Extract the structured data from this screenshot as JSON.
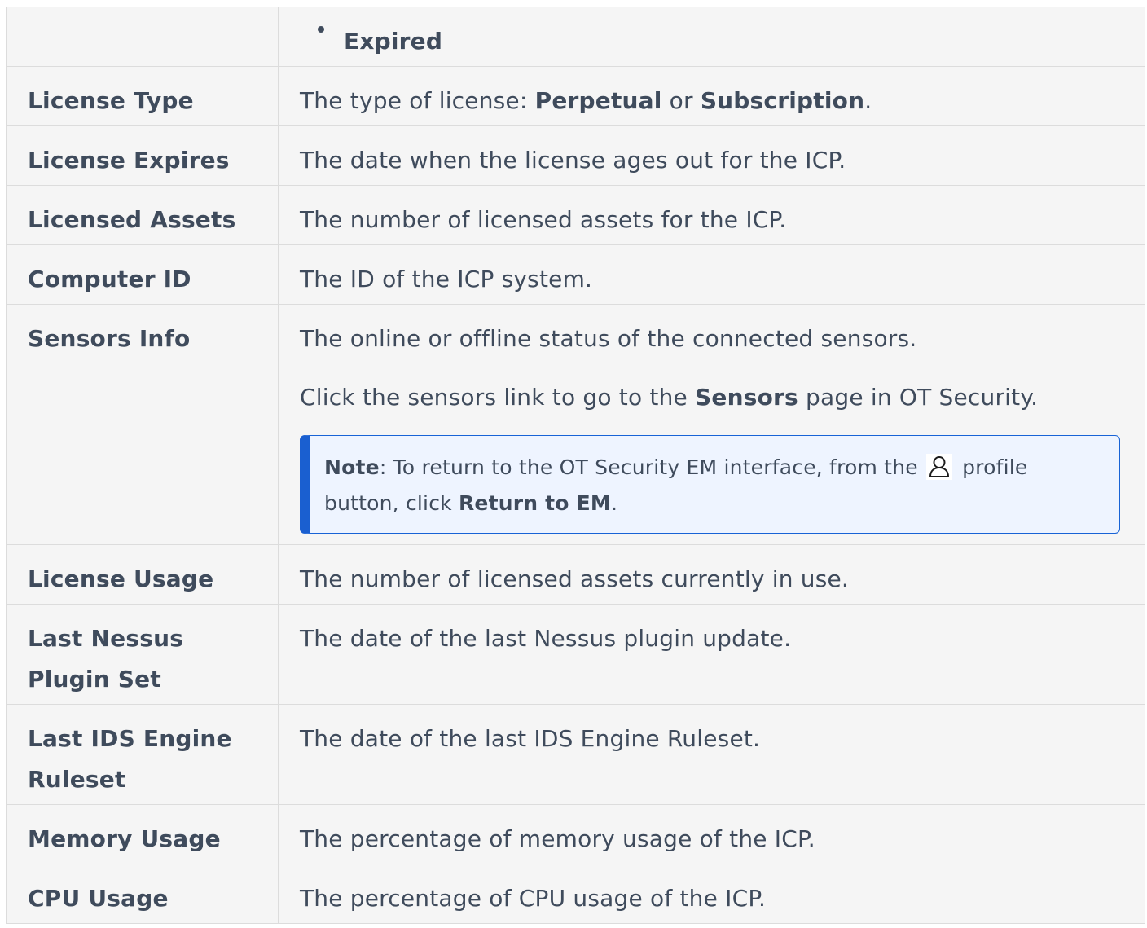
{
  "rows": {
    "expired_row": {
      "term": "",
      "bullet": "Expired"
    },
    "license_type": {
      "term": "License Type",
      "desc_prefix": "The type of license: ",
      "opt1": "Perpetual",
      "mid": " or ",
      "opt2": "Subscription",
      "desc_suffix": "."
    },
    "license_expires": {
      "term": "License Expires",
      "desc": "The date when the license ages out for the ICP."
    },
    "licensed_assets": {
      "term": "Licensed Assets",
      "desc": "The number of licensed assets for the ICP."
    },
    "computer_id": {
      "term": "Computer ID",
      "desc": "The ID of the ICP system."
    },
    "sensors_info": {
      "term": "Sensors Info",
      "desc": "The online or offline status of the connected sensors.",
      "para2_prefix": "Click the sensors link to go to the ",
      "para2_bold": "Sensors",
      "para2_suffix": " page in OT Security.",
      "note": {
        "label": "Note",
        "text1": ": To return to the OT Security EM interface, from the ",
        "icon": "profile-icon",
        "text2": " profile button, click ",
        "bold": "Return to EM",
        "text3": "."
      }
    },
    "license_usage": {
      "term": "License Usage",
      "desc": "The number of licensed assets currently in use."
    },
    "last_nessus": {
      "term": "Last Nessus Plugin Set",
      "desc": "The date of the last Nessus plugin update."
    },
    "last_ids": {
      "term": "Last IDS Engine Ruleset",
      "desc": "The date of the last IDS Engine Ruleset."
    },
    "memory_usage": {
      "term": "Memory Usage",
      "desc": "The percentage of memory usage of the ICP."
    },
    "cpu_usage": {
      "term": "CPU Usage",
      "desc": "The percentage of CPU usage of the ICP."
    }
  },
  "colors": {
    "text": "#3f4b5c",
    "cell_bg": "#f5f5f5",
    "border": "#dcdcdc",
    "note_bg": "#eef4ff",
    "note_accent": "#1a5fd0"
  }
}
